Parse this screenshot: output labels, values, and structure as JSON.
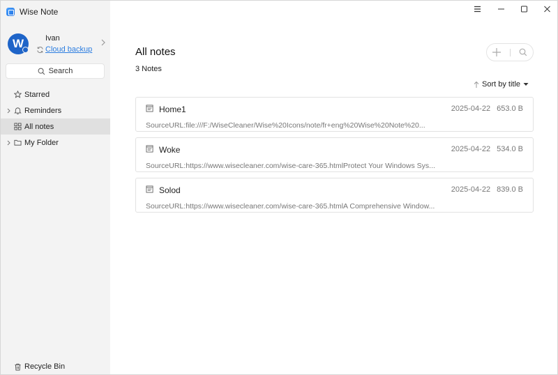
{
  "app": {
    "title": "Wise Note"
  },
  "user": {
    "initial": "W",
    "name": "Ivan",
    "cloud_label": "Cloud backup"
  },
  "sidebar": {
    "search_label": "Search",
    "items": [
      {
        "label": "Starred",
        "icon": "star-icon"
      },
      {
        "label": "Reminders",
        "icon": "bell-icon"
      },
      {
        "label": "All notes",
        "icon": "grid-icon"
      },
      {
        "label": "My Folder",
        "icon": "folder-icon"
      }
    ],
    "recycle_label": "Recycle Bin"
  },
  "main": {
    "title": "All notes",
    "count_label": "3 Notes",
    "sort_label": "Sort by title",
    "notes": [
      {
        "title": "Home1",
        "date": "2025-04-22",
        "size": "653.0 B",
        "snippet": "SourceURL:file:///F:/WiseCleaner/Wise%20Icons/note/fr+eng%20Wise%20Note%20..."
      },
      {
        "title": "Woke",
        "date": "2025-04-22",
        "size": "534.0 B",
        "snippet": "SourceURL:https://www.wisecleaner.com/wise-care-365.htmlProtect Your Windows Sys..."
      },
      {
        "title": "Solod",
        "date": "2025-04-22",
        "size": "839.0 B",
        "snippet": "SourceURL:https://www.wisecleaner.com/wise-care-365.htmlA Comprehensive Window..."
      }
    ]
  },
  "colors": {
    "accent": "#2b7de0",
    "avatar": "#1e64c8",
    "sidebar_bg": "#f3f3f3",
    "active_item": "#e0e0e0"
  }
}
